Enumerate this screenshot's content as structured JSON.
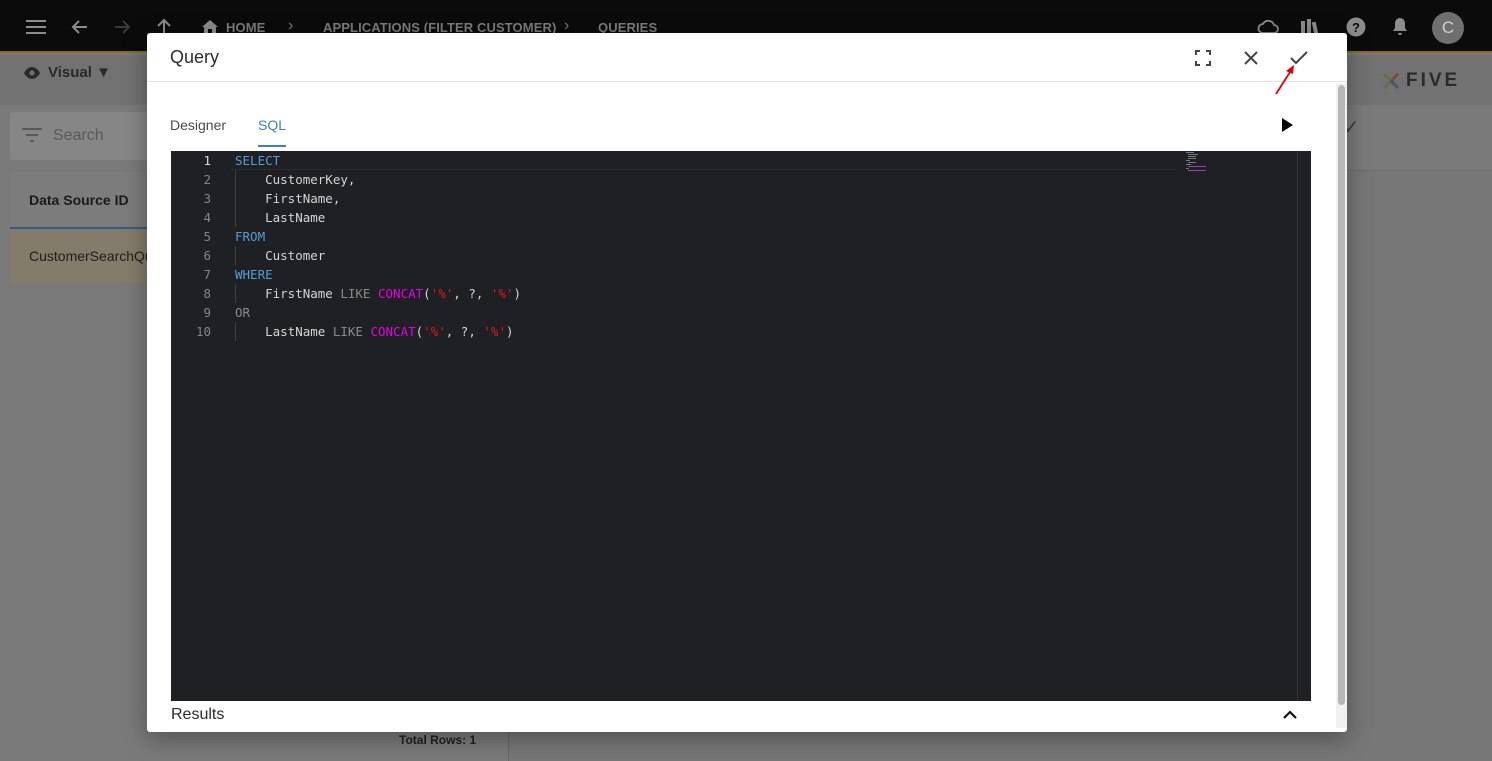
{
  "topbar": {
    "breadcrumbs": [
      "HOME",
      "APPLICATIONS (FILTER CUSTOMER)",
      "QUERIES"
    ],
    "avatar_initial": "C"
  },
  "subbar": {
    "view_mode": "Visual ▼",
    "logo_text": "FIVE"
  },
  "list": {
    "search_placeholder": "Search",
    "column_header": "Data Source ID",
    "rows": [
      "CustomerSearchQuery"
    ],
    "total_rows": "Total Rows: 1"
  },
  "modal": {
    "title": "Query",
    "tabs": [
      {
        "label": "Designer",
        "active": false
      },
      {
        "label": "SQL",
        "active": true
      }
    ],
    "results_label": "Results"
  },
  "editor": {
    "current_line": 1,
    "lines": [
      {
        "n": "1",
        "tokens": [
          {
            "t": "SELECT",
            "c": "kw"
          }
        ]
      },
      {
        "n": "2",
        "tokens": [
          {
            "t": "    CustomerKey,",
            "c": ""
          }
        ]
      },
      {
        "n": "3",
        "tokens": [
          {
            "t": "    FirstName,",
            "c": ""
          }
        ]
      },
      {
        "n": "4",
        "tokens": [
          {
            "t": "    LastName",
            "c": ""
          }
        ]
      },
      {
        "n": "5",
        "tokens": [
          {
            "t": "FROM",
            "c": "kw"
          }
        ]
      },
      {
        "n": "6",
        "tokens": [
          {
            "t": "    Customer",
            "c": ""
          }
        ]
      },
      {
        "n": "7",
        "tokens": [
          {
            "t": "WHERE",
            "c": "kw"
          }
        ]
      },
      {
        "n": "8",
        "tokens": [
          {
            "t": "    FirstName ",
            "c": ""
          },
          {
            "t": "LIKE",
            "c": "op"
          },
          {
            "t": " ",
            "c": ""
          },
          {
            "t": "CONCAT",
            "c": "fn"
          },
          {
            "t": "(",
            "c": ""
          },
          {
            "t": "'%'",
            "c": "str"
          },
          {
            "t": ", ?, ",
            "c": ""
          },
          {
            "t": "'%'",
            "c": "str"
          },
          {
            "t": ")",
            "c": ""
          }
        ]
      },
      {
        "n": "9",
        "tokens": [
          {
            "t": "OR",
            "c": "op"
          }
        ]
      },
      {
        "n": "10",
        "tokens": [
          {
            "t": "    LastName ",
            "c": ""
          },
          {
            "t": "LIKE",
            "c": "op"
          },
          {
            "t": " ",
            "c": ""
          },
          {
            "t": "CONCAT",
            "c": "fn"
          },
          {
            "t": "(",
            "c": ""
          },
          {
            "t": "'%'",
            "c": "str"
          },
          {
            "t": ", ?, ",
            "c": ""
          },
          {
            "t": "'%'",
            "c": "str"
          },
          {
            "t": ")",
            "c": ""
          }
        ]
      }
    ]
  },
  "icons": {
    "menu": "menu-icon",
    "back": "arrow-left-icon",
    "forward": "arrow-right-icon",
    "up": "arrow-up-icon",
    "home": "home-icon",
    "cloud": "cloud-sync-icon",
    "books": "library-icon",
    "help": "help-icon",
    "bell": "bell-icon",
    "fullscreen": "fullscreen-icon",
    "close": "close-icon",
    "confirm": "check-icon",
    "run": "play-icon",
    "collapse": "chevron-up-icon"
  },
  "colors": {
    "accent": "#3b82c4",
    "keyword": "#569cd6",
    "function": "#e600e6",
    "string": "#e51c1c",
    "editor_bg": "#1f2023",
    "annotation_arrow": "#e00000"
  }
}
